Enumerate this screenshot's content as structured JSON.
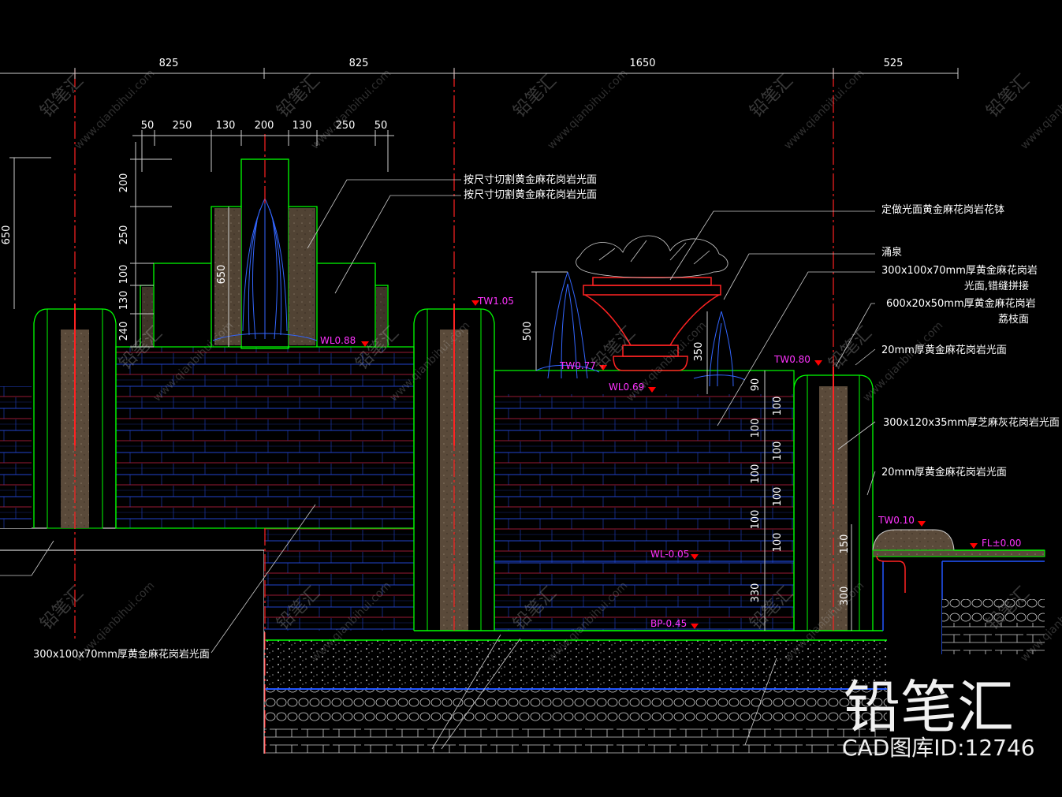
{
  "drawing": {
    "colors": {
      "background": "#000000",
      "structure": "#00ff00",
      "axis": "#ff2222",
      "water": "#2255ff",
      "fountain": "#3366ff",
      "dimension": "#ffffff",
      "level_marker": "#ff33ff",
      "marker_triangle": "#ff0000",
      "stone_fill": "#6a5a48"
    },
    "top_dims": [
      "825",
      "825",
      "1650",
      "525"
    ],
    "pillar_dims": [
      "50",
      "250",
      "130",
      "200",
      "130",
      "250",
      "50"
    ],
    "left_vertical_dims": [
      "650",
      "200",
      "250",
      "100",
      "130",
      "240"
    ],
    "inner_dims": [
      "650",
      "500",
      "350"
    ],
    "right_vertical_dims": [
      "90",
      "100",
      "100",
      "100",
      "100",
      "100",
      "100",
      "100",
      "100",
      "330"
    ],
    "small_right_dims": [
      "150",
      "300"
    ],
    "annotations": [
      "按尺寸切割黄金麻花岗岩光面",
      "按尺寸切割黄金麻花岗岩光面",
      "定做光面黄金麻花岗岩花钵",
      "涌泉",
      "300x100x70mm厚黄金麻花岗岩",
      "光面,错缝拼接",
      "600x20x50mm厚黄金麻花岗岩",
      "荔枝面",
      "20mm厚黄金麻花岗岩光面",
      "300x120x35mm厚芝麻灰花岗岩光面",
      "20mm厚黄金麻花岗岩光面",
      "300x100x70mm厚黄金麻花岗岩光面"
    ],
    "levels": [
      "TW1.05",
      "WL0.88",
      "TW0.77",
      "WL0.69",
      "TW0.80",
      "WL-0.05",
      "BP-0.45",
      "TW0.10",
      "FL±0.00"
    ]
  },
  "watermark": {
    "brand": "铅笔汇",
    "caption": "CAD图库ID:12746",
    "url": "www.qianbihui.com"
  }
}
